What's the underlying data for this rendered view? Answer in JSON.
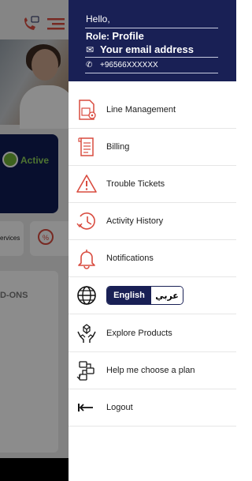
{
  "background": {
    "status_text": "Active",
    "services_text": "ervices",
    "addons_text": "D-ONS",
    "offer_icon_text": "%"
  },
  "drawer": {
    "header": {
      "greeting": "Hello,",
      "role_label": "Role:",
      "role_value": "Profile",
      "email": "Your email address",
      "phone": "+96566XXXXXX"
    },
    "menu": {
      "line_management": "Line Management",
      "billing": "Billing",
      "trouble_tickets": "Trouble Tickets",
      "activity_history": "Activity History",
      "notifications": "Notifications",
      "explore_products": "Explore Products",
      "help_choose_plan": "Help me choose a plan",
      "logout": "Logout"
    },
    "language": {
      "english": "English",
      "arabic": "عربي",
      "selected": "English"
    }
  },
  "colors": {
    "header_navy": "#192055",
    "icon_red": "#d94b3f",
    "status_green": "#6fb338"
  },
  "icons": {
    "line_management": "sim-card-gear-icon",
    "billing": "bill-document-icon",
    "trouble_tickets": "warning-triangle-icon",
    "activity_history": "clock-history-icon",
    "notifications": "bell-icon",
    "language": "globe-icon",
    "explore_products": "hands-box-icon",
    "help_choose_plan": "plan-chooser-icon",
    "logout": "logout-arrow-icon"
  }
}
